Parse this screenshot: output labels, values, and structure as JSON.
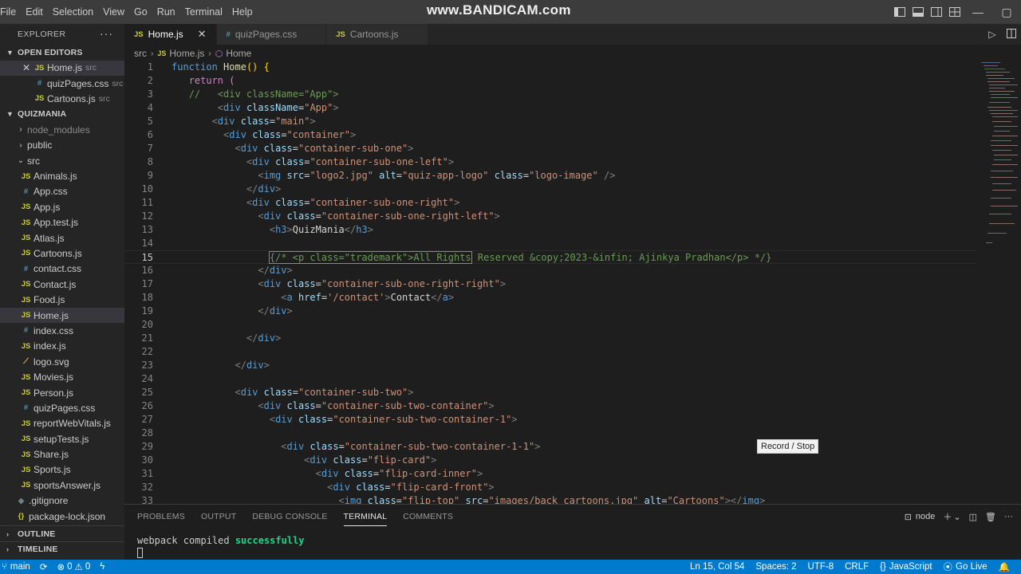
{
  "menu": [
    "File",
    "Edit",
    "Selection",
    "View",
    "Go",
    "Run",
    "Terminal",
    "Help"
  ],
  "watermark": "www.BANDICAM.com",
  "sidebar": {
    "title": "EXPLORER",
    "more": "···",
    "open_editors": {
      "label": "OPEN EDITORS",
      "items": [
        {
          "icon": "JS",
          "name": "Home.js",
          "desc": "src"
        },
        {
          "icon": "#",
          "name": "quizPages.css",
          "desc": "src"
        },
        {
          "icon": "JS",
          "name": "Cartoons.js",
          "desc": "src"
        }
      ]
    },
    "project": {
      "label": "QUIZMANIA",
      "node_modules": "node_modules",
      "public": "public",
      "src": "src",
      "files": [
        {
          "icon": "JS",
          "name": "Animals.js"
        },
        {
          "icon": "#",
          "name": "App.css"
        },
        {
          "icon": "JS",
          "name": "App.js"
        },
        {
          "icon": "JS",
          "name": "App.test.js"
        },
        {
          "icon": "JS",
          "name": "Atlas.js"
        },
        {
          "icon": "JS",
          "name": "Cartoons.js"
        },
        {
          "icon": "#",
          "name": "contact.css"
        },
        {
          "icon": "JS",
          "name": "Contact.js"
        },
        {
          "icon": "JS",
          "name": "Food.js"
        },
        {
          "icon": "JS",
          "name": "Home.js"
        },
        {
          "icon": "#",
          "name": "index.css"
        },
        {
          "icon": "JS",
          "name": "index.js"
        },
        {
          "icon": "⟋",
          "name": "logo.svg"
        },
        {
          "icon": "JS",
          "name": "Movies.js"
        },
        {
          "icon": "JS",
          "name": "Person.js"
        },
        {
          "icon": "#",
          "name": "quizPages.css"
        },
        {
          "icon": "JS",
          "name": "reportWebVitals.js"
        },
        {
          "icon": "JS",
          "name": "setupTests.js"
        },
        {
          "icon": "JS",
          "name": "Share.js"
        },
        {
          "icon": "JS",
          "name": "Sports.js"
        },
        {
          "icon": "JS",
          "name": "sportsAnswer.js"
        }
      ],
      "gitignore": ".gitignore",
      "package_lock": "package-lock.json"
    },
    "outline": "OUTLINE",
    "timeline": "TIMELINE"
  },
  "tabs": [
    {
      "icon": "JS",
      "label": "Home.js"
    },
    {
      "icon": "#",
      "label": "quizPages.css"
    },
    {
      "icon": "JS",
      "label": "Cartoons.js"
    }
  ],
  "breadcrumb": {
    "folder": "src",
    "file_icon": "JS",
    "file": "Home.js",
    "symbol": "Home"
  },
  "editor": {
    "line_numbers": [
      "1",
      "2",
      "3",
      "4",
      "5",
      "6",
      "7",
      "8",
      "9",
      "10",
      "11",
      "12",
      "13",
      "14",
      "15",
      "16",
      "17",
      "18",
      "19",
      "20",
      "21",
      "22",
      "23",
      "24",
      "25",
      "26",
      "27",
      "28",
      "29",
      "30",
      "31",
      "32",
      "33"
    ],
    "lines": {
      "l1a": "function",
      "l1b": "Home",
      "l1c": "() {",
      "l2": "return (",
      "l3": "//   <div className=\"App\">",
      "l4a": "div",
      "l4b": "className",
      "l4c": "\"App\"",
      "l5a": "div",
      "l5b": "class",
      "l5c": "\"main\"",
      "l6a": "div",
      "l6b": "class",
      "l6c": "\"container\"",
      "l7a": "div",
      "l7b": "class",
      "l7c": "\"container-sub-one\"",
      "l8a": "div",
      "l8b": "class",
      "l8c": "\"container-sub-one-left\"",
      "l9a": "img",
      "l9b": "src",
      "l9c": "\"logo2.jpg\"",
      "l9d": "alt",
      "l9e": "\"quiz-app-logo\"",
      "l9f": "class",
      "l9g": "\"logo-image\"",
      "l10": "div",
      "l11a": "div",
      "l11b": "class",
      "l11c": "\"container-sub-one-right\"",
      "l12a": "div",
      "l12b": "class",
      "l12c": "\"container-sub-one-right-left\"",
      "l13a": "h3",
      "l13b": "QuizMania",
      "l13c": "h3",
      "l15a": "{/* <p class=\"trademark\">All Rights",
      "l15b": " Reserved &copy;2023-&infin; Ajinkya Pradhan</p> */}",
      "l16": "div",
      "l17a": "div",
      "l17b": "class",
      "l17c": "\"container-sub-one-right-right\"",
      "l18a": "a",
      "l18b": "href",
      "l18c": "'/contact'",
      "l18d": "Contact",
      "l18e": "a",
      "l19": "div",
      "l21": "div",
      "l23": "div",
      "l25a": "div",
      "l25b": "class",
      "l25c": "\"container-sub-two\"",
      "l26a": "div",
      "l26b": "class",
      "l26c": "\"container-sub-two-container\"",
      "l27a": "div",
      "l27b": "class",
      "l27c": "\"container-sub-two-container-1\"",
      "l29a": "div",
      "l29b": "class",
      "l29c": "\"container-sub-two-container-1-1\"",
      "l30a": "div",
      "l30b": "class",
      "l30c": "\"flip-card\"",
      "l31a": "div",
      "l31b": "class",
      "l31c": "\"flip-card-inner\"",
      "l32a": "div",
      "l32b": "class",
      "l32c": "\"flip-card-front\"",
      "l33a": "img",
      "l33b": "class",
      "l33c": "\"flip-top\"",
      "l33d": "src",
      "l33e": "\"images/back_cartoons.jpg\"",
      "l33f": "alt",
      "l33g": "\"Cartoons\"",
      "l33h": "img"
    }
  },
  "tooltip": "Record / Stop",
  "panel": {
    "tabs": [
      "PROBLEMS",
      "OUTPUT",
      "DEBUG CONSOLE",
      "TERMINAL",
      "COMMENTS"
    ],
    "active_tab": "TERMINAL",
    "shell": "node",
    "terminal_prefix": "webpack compiled ",
    "terminal_status": "successfully"
  },
  "statusbar": {
    "branch": "main",
    "errors": "0",
    "warnings": "0",
    "position": "Ln 15, Col 54",
    "spaces": "Spaces: 2",
    "encoding": "UTF-8",
    "eol": "CRLF",
    "language": "JavaScript",
    "golive": "Go Live"
  },
  "colors": {
    "accent": "#007acc",
    "success": "#23d18b"
  }
}
